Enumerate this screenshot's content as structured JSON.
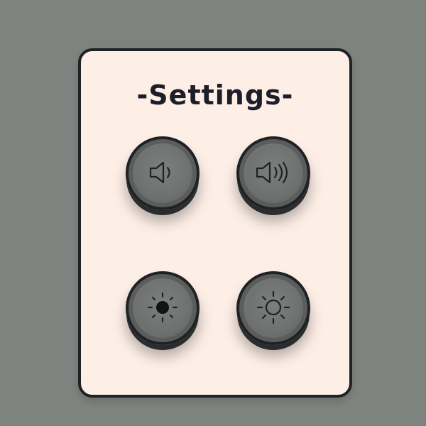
{
  "panel": {
    "title": "-Settings-"
  },
  "buttons": [
    {
      "name": "volume-down-button",
      "icon": "speaker-low-icon"
    },
    {
      "name": "volume-up-button",
      "icon": "speaker-high-icon"
    },
    {
      "name": "brightness-down-button",
      "icon": "sun-filled-icon"
    },
    {
      "name": "brightness-up-button",
      "icon": "sun-outline-icon"
    }
  ],
  "colors": {
    "background": "#7f837f",
    "panel": "#fdeee6",
    "outline": "#1f2225",
    "button": "#6e716f"
  }
}
